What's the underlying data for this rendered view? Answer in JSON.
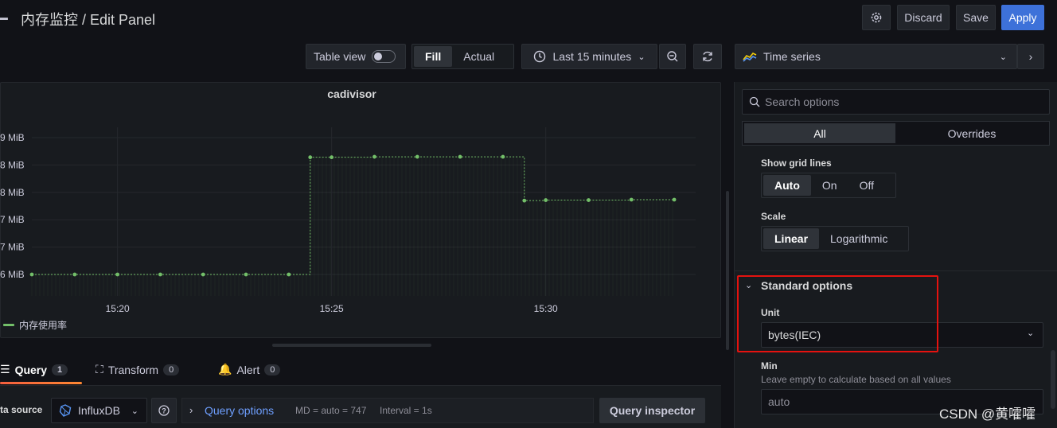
{
  "header": {
    "title": "内存监控 / Edit Panel",
    "discard_label": "Discard",
    "save_label": "Save",
    "apply_label": "Apply"
  },
  "toolbar": {
    "table_view_label": "Table view",
    "fill_label": "Fill",
    "actual_label": "Actual",
    "time_range_label": "Last 15 minutes",
    "viz_label": "Time series"
  },
  "panel": {
    "title": "cadivisor",
    "legend": "内存使用率"
  },
  "chart_data": {
    "type": "line",
    "title": "cadivisor",
    "y_tick_labels": [
      "9 MiB",
      "8 MiB",
      "8 MiB",
      "7 MiB",
      "7 MiB",
      "6 MiB"
    ],
    "x_tick_labels": [
      "15:20",
      "15:25",
      "15:30"
    ],
    "series": [
      {
        "name": "内存使用率",
        "color": "#73bf69",
        "x": [
          "15:18",
          "15:19",
          "15:20",
          "15:21",
          "15:22",
          "15:23",
          "15:24",
          "15:24.5",
          "15:25",
          "15:26",
          "15:27",
          "15:28",
          "15:29",
          "15:29.5",
          "15:30",
          "15:31",
          "15:32",
          "15:33"
        ],
        "values": [
          6.0,
          6.0,
          6.0,
          6.0,
          6.0,
          6.0,
          6.0,
          8.57,
          8.57,
          8.58,
          8.58,
          8.58,
          8.58,
          7.62,
          7.63,
          7.63,
          7.64,
          7.64
        ]
      }
    ]
  },
  "tabs": [
    {
      "label": "Query",
      "count": "1"
    },
    {
      "label": "Transform",
      "count": "0"
    },
    {
      "label": "Alert",
      "count": "0"
    }
  ],
  "query": {
    "data_source_label": "ta source",
    "datasource": "InfluxDB",
    "query_options_label": "Query options",
    "md_text": "MD = auto = 747",
    "interval_text": "Interval = 1s",
    "inspector_label": "Query inspector"
  },
  "options": {
    "search_placeholder": "Search options",
    "all_label": "All",
    "overrides_label": "Overrides",
    "grid_lines_label": "Show grid lines",
    "grid_auto": "Auto",
    "grid_on": "On",
    "grid_off": "Off",
    "scale_label": "Scale",
    "scale_linear": "Linear",
    "scale_log": "Logarithmic",
    "standard_options_label": "Standard options",
    "unit_label": "Unit",
    "unit_value": "bytes(IEC)",
    "min_label": "Min",
    "min_desc": "Leave empty to calculate based on all values",
    "min_placeholder": "auto"
  },
  "watermark": "CSDN @黄嚯嚯"
}
